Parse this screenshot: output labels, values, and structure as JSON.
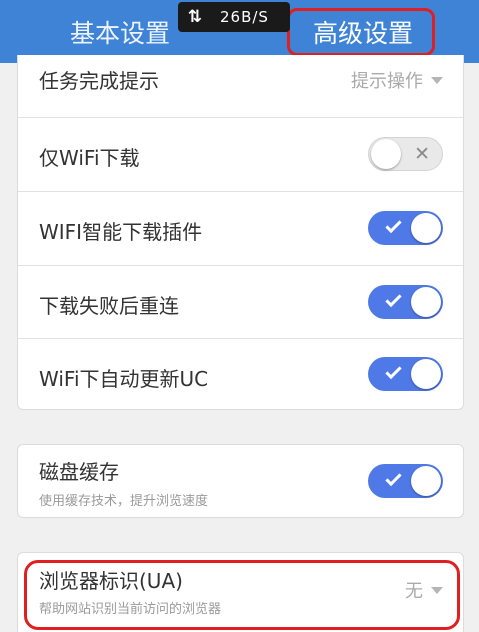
{
  "tabs": [
    {
      "label": "基本设置",
      "selected": false
    },
    {
      "label": "高级设置",
      "selected": true
    }
  ],
  "status_overlay": {
    "speed": "26B/S",
    "icon": "up-down-arrows-icon"
  },
  "settings_group1": [
    {
      "label": "任务完成提示",
      "control": "select",
      "value": "提示操作"
    },
    {
      "label": "仅WiFi下载",
      "control": "toggle",
      "on": false
    },
    {
      "label": "WIFI智能下载插件",
      "control": "toggle",
      "on": true
    },
    {
      "label": "下载失败后重连",
      "control": "toggle",
      "on": true
    },
    {
      "label": "WiFi下自动更新UC",
      "control": "toggle",
      "on": true
    }
  ],
  "settings_group2": {
    "label": "磁盘缓存",
    "description": "使用缓存技术，提升浏览速度",
    "control": "toggle",
    "on": true
  },
  "settings_group3": {
    "label": "浏览器标识(UA)",
    "description": "帮助网站识别当前访问的浏览器",
    "control": "select",
    "value": "无"
  },
  "colors": {
    "header": "#3f83d6",
    "toggle_on": "#4f79e6",
    "annotation": "#e02020"
  }
}
